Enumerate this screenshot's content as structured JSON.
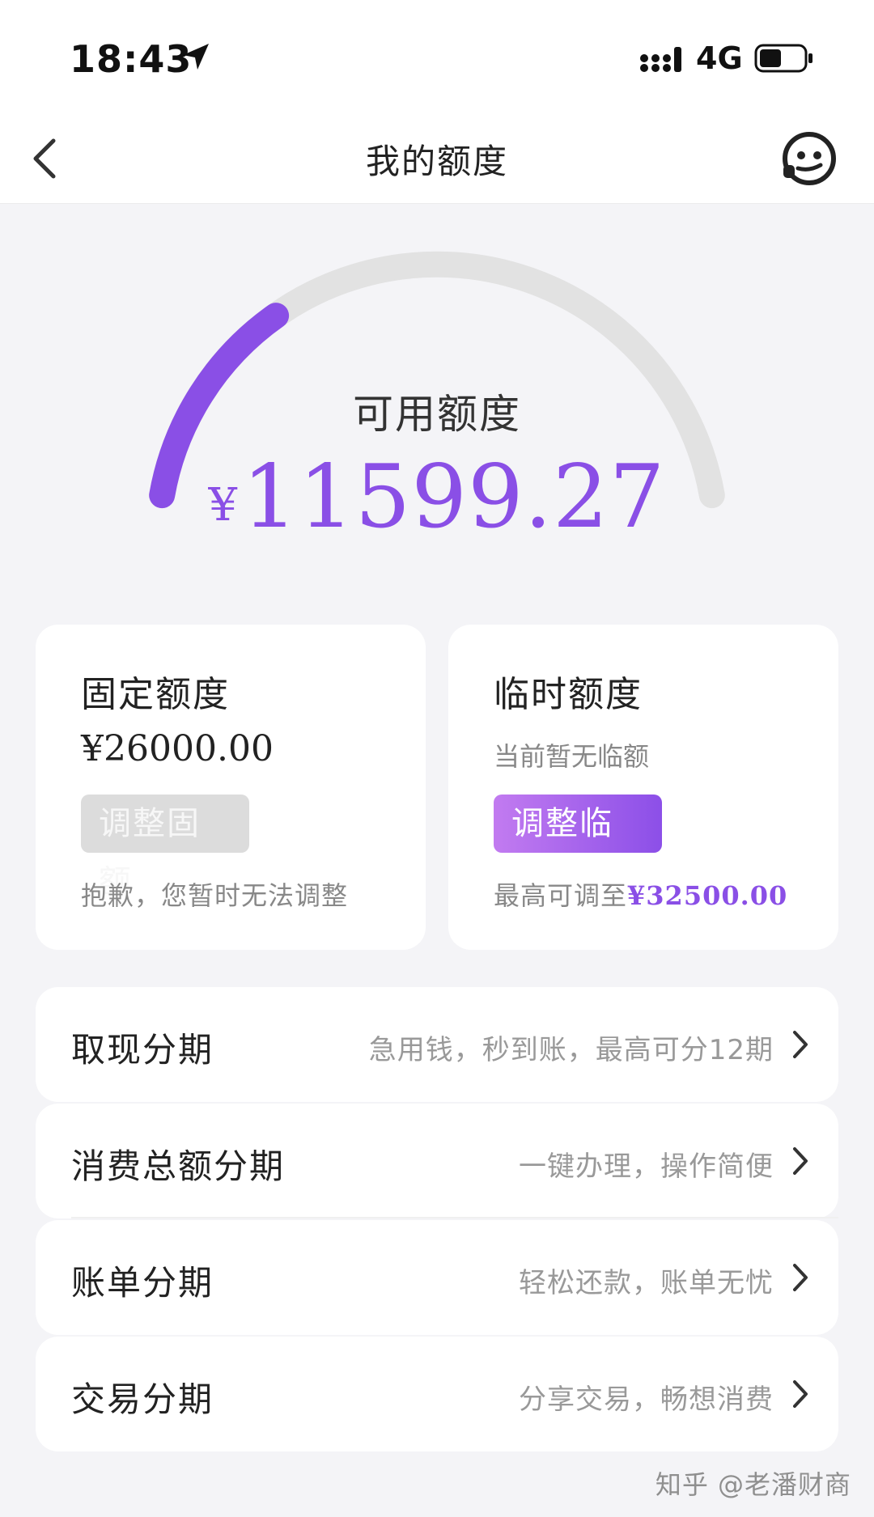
{
  "status_bar": {
    "time": "18:43",
    "network": "4G",
    "battery_level": 0.5
  },
  "nav": {
    "title": "我的额度"
  },
  "gauge": {
    "label": "可用额度",
    "currency": "¥",
    "amount": "11599.27",
    "used_fraction": 0.28,
    "accent_color": "#8a4fe6",
    "track_color": "#e2e2e2"
  },
  "fixed_limit": {
    "title": "固定额度",
    "value": "¥26000.00",
    "button_label": "调整固额",
    "note": "抱歉，您暂时无法调整"
  },
  "temp_limit": {
    "title": "临时额度",
    "status": "当前暂无临额",
    "button_label": "调整临额",
    "note_prefix": "最高可调至",
    "note_value": "¥32500.00"
  },
  "installments": [
    {
      "title": "取现分期",
      "desc": "急用钱，秒到账，最高可分12期"
    },
    {
      "title": "消费总额分期",
      "desc": "一键办理，操作简便"
    },
    {
      "title": "账单分期",
      "desc": "轻松还款，账单无忧"
    },
    {
      "title": "交易分期",
      "desc": "分享交易，畅想消费"
    }
  ],
  "watermark": "知乎 @老潘财商"
}
